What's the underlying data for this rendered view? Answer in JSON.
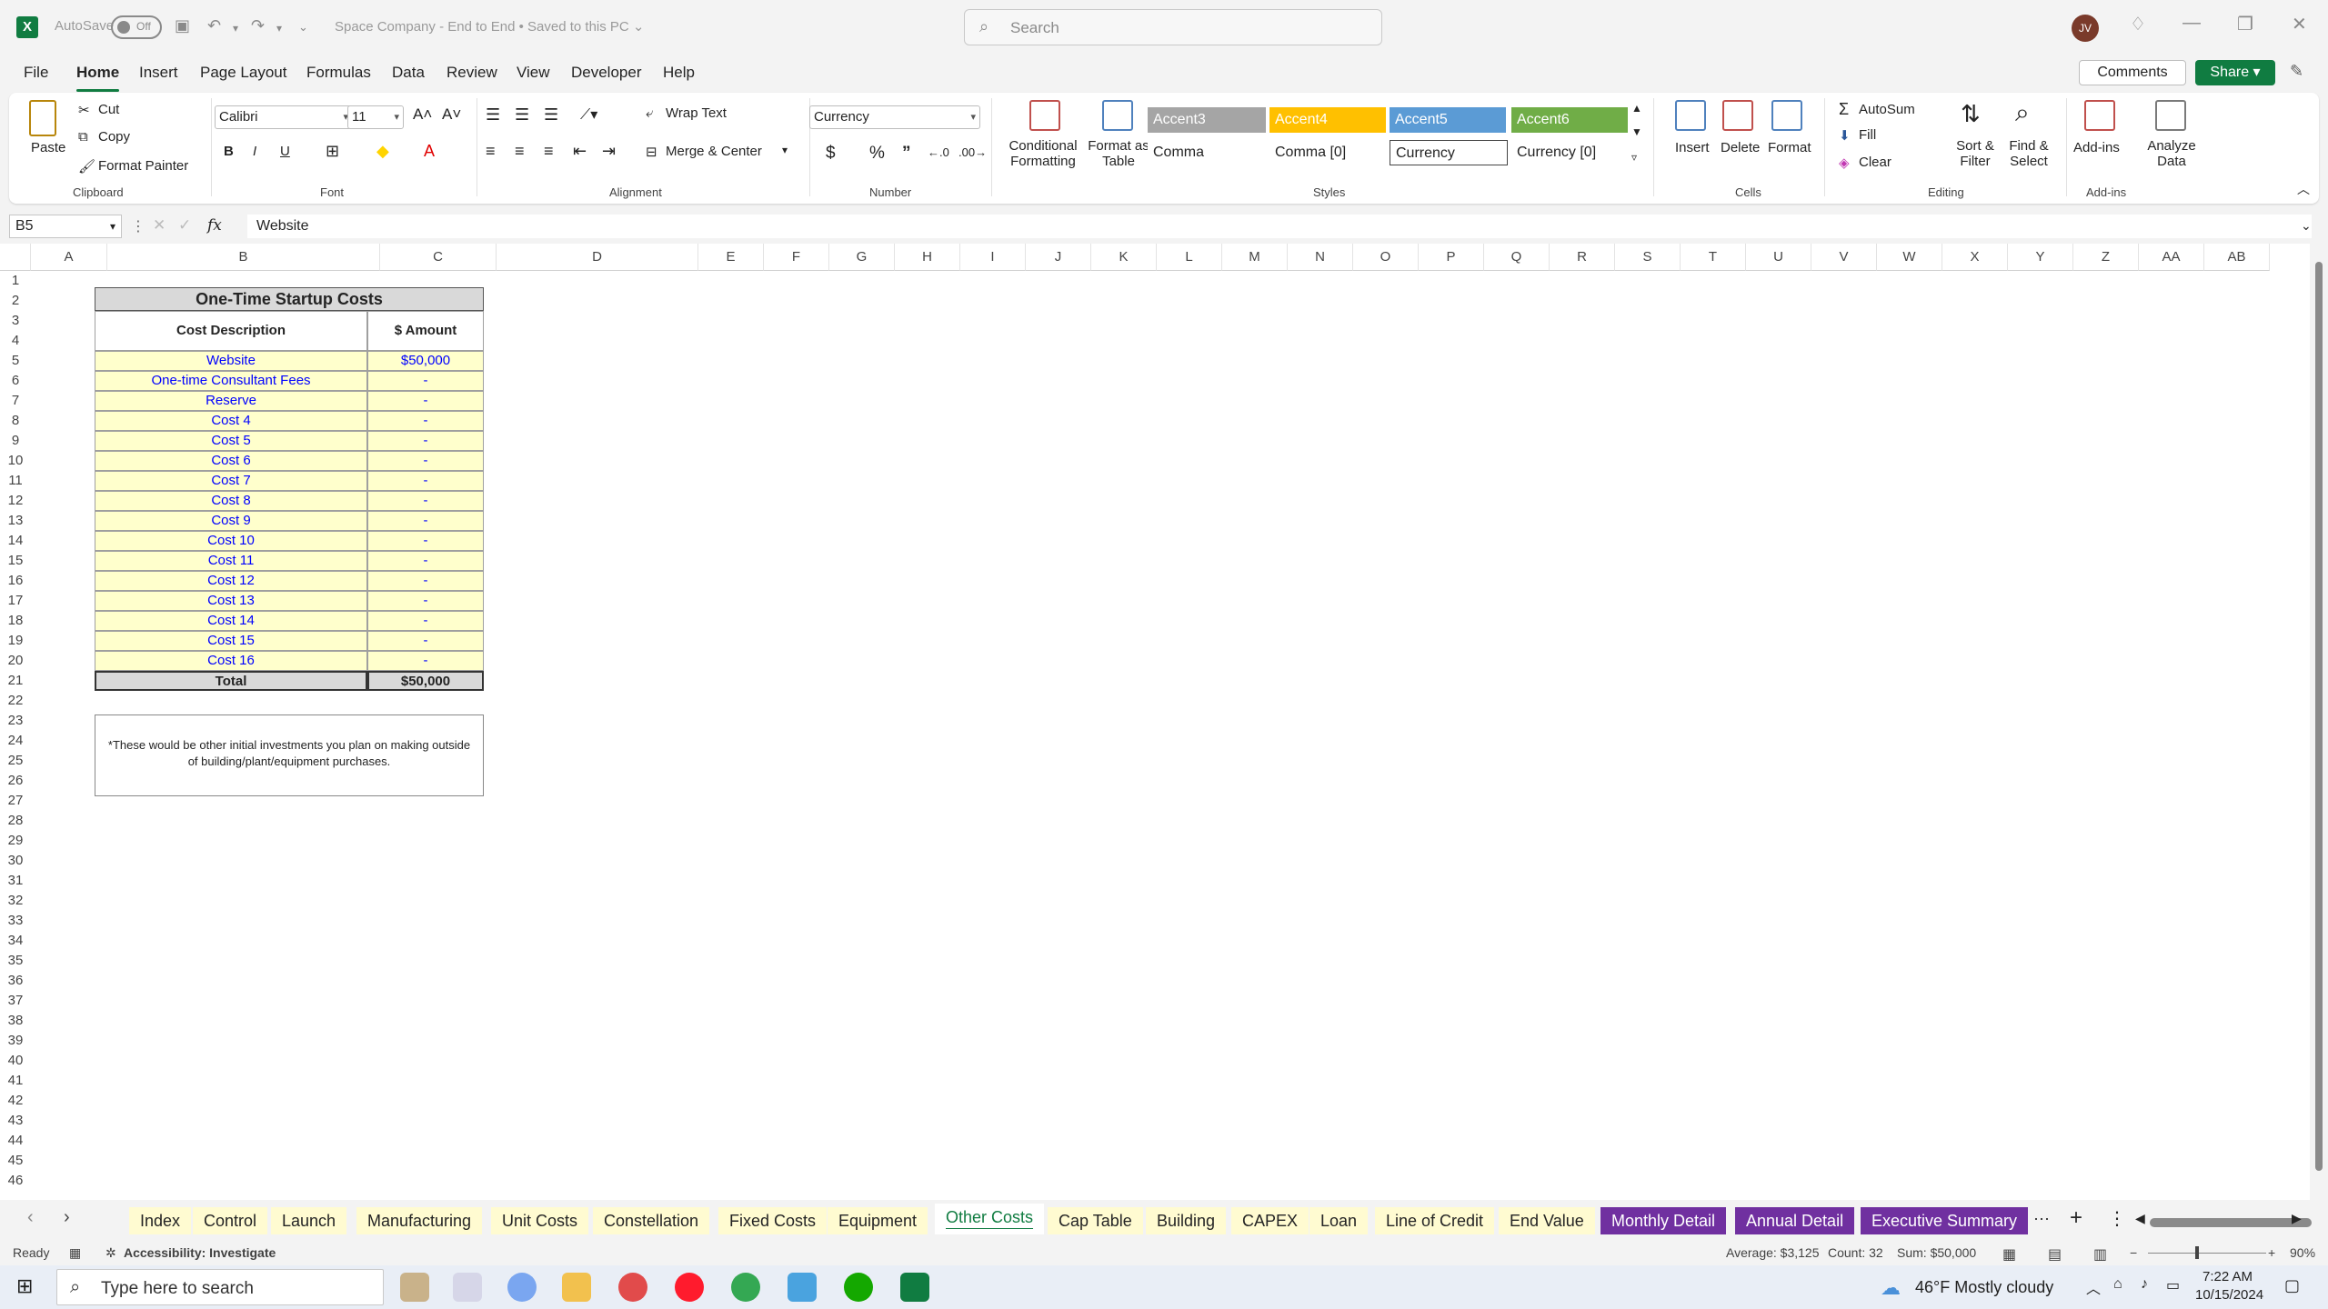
{
  "titlebar": {
    "autosave_label": "AutoSave",
    "autosave_state": "Off",
    "doc_title": "Space Company - End to End • Saved to this PC ⌄",
    "search_placeholder": "Search",
    "user_initials": "JV"
  },
  "menu": {
    "items": [
      "File",
      "Home",
      "Insert",
      "Page Layout",
      "Formulas",
      "Data",
      "Review",
      "View",
      "Developer",
      "Help"
    ],
    "active": "Home",
    "comments_label": "Comments",
    "share_label": "Share"
  },
  "ribbon": {
    "clipboard": {
      "paste": "Paste",
      "cut": "Cut",
      "copy": "Copy",
      "format_painter": "Format Painter",
      "label": "Clipboard"
    },
    "font": {
      "name": "Calibri",
      "size": "11",
      "label": "Font",
      "bold": "B",
      "italic": "I",
      "underline": "U"
    },
    "alignment": {
      "wrap_text": "Wrap Text",
      "merge_center": "Merge & Center",
      "label": "Alignment"
    },
    "number": {
      "format": "Currency",
      "currency_symbol": "$",
      "percent": "%",
      "comma": "”",
      "label": "Number"
    },
    "styles": {
      "conditional_formatting": "Conditional Formatting",
      "format_as_table": "Format as Table",
      "cells": [
        {
          "name": "Accent3",
          "bg": "#a5a5a5",
          "fg": "#ffffff"
        },
        {
          "name": "Accent4",
          "bg": "#ffc000",
          "fg": "#ffffff"
        },
        {
          "name": "Accent5",
          "bg": "#5b9bd5",
          "fg": "#ffffff"
        },
        {
          "name": "Accent6",
          "bg": "#70ad47",
          "fg": "#ffffff"
        },
        {
          "name": "Comma",
          "bg": "#ffffff",
          "fg": "#242424"
        },
        {
          "name": "Comma [0]",
          "bg": "#ffffff",
          "fg": "#242424"
        },
        {
          "name": "Currency",
          "bg": "#ffffff",
          "fg": "#242424"
        },
        {
          "name": "Currency [0]",
          "bg": "#ffffff",
          "fg": "#242424"
        }
      ],
      "label": "Styles"
    },
    "cells": {
      "insert": "Insert",
      "delete": "Delete",
      "format": "Format",
      "label": "Cells"
    },
    "editing": {
      "autosum": "AutoSum",
      "fill": "Fill",
      "clear": "Clear",
      "sort_filter": "Sort & Filter",
      "find_select": "Find & Select",
      "label": "Editing"
    },
    "addins": {
      "addins": "Add-ins",
      "analyze": "Analyze Data",
      "label": "Add-ins"
    }
  },
  "formula_bar": {
    "name_box": "B5",
    "fx": "fx",
    "value": "Website"
  },
  "columns": [
    "A",
    "B",
    "C",
    "D",
    "E",
    "F",
    "G",
    "H",
    "I",
    "J",
    "K",
    "L",
    "M",
    "N",
    "O",
    "P",
    "Q",
    "R",
    "S",
    "T",
    "U",
    "V",
    "W",
    "X",
    "Y",
    "Z",
    "AA",
    "AB"
  ],
  "rows": [
    "1",
    "2",
    "3",
    "4",
    "5",
    "6",
    "7",
    "8",
    "9",
    "10",
    "11",
    "12",
    "13",
    "14",
    "15",
    "16",
    "17",
    "18",
    "19",
    "20",
    "21",
    "22",
    "23",
    "24",
    "25",
    "26",
    "27",
    "28",
    "29",
    "30",
    "31",
    "32",
    "33",
    "34",
    "35",
    "36",
    "37",
    "38",
    "39",
    "40",
    "41",
    "42",
    "43",
    "44",
    "45",
    "46"
  ],
  "table": {
    "title": "One-Time Startup Costs",
    "header_desc": "Cost Description",
    "header_amount": "$ Amount",
    "rows": [
      {
        "desc": "Website",
        "amount": "$50,000"
      },
      {
        "desc": "One-time Consultant Fees",
        "amount": "-"
      },
      {
        "desc": "Reserve",
        "amount": "-"
      },
      {
        "desc": "Cost 4",
        "amount": "-"
      },
      {
        "desc": "Cost 5",
        "amount": "-"
      },
      {
        "desc": "Cost 6",
        "amount": "-"
      },
      {
        "desc": "Cost 7",
        "amount": "-"
      },
      {
        "desc": "Cost 8",
        "amount": "-"
      },
      {
        "desc": "Cost 9",
        "amount": "-"
      },
      {
        "desc": "Cost 10",
        "amount": "-"
      },
      {
        "desc": "Cost 11",
        "amount": "-"
      },
      {
        "desc": "Cost 12",
        "amount": "-"
      },
      {
        "desc": "Cost 13",
        "amount": "-"
      },
      {
        "desc": "Cost 14",
        "amount": "-"
      },
      {
        "desc": "Cost 15",
        "amount": "-"
      },
      {
        "desc": "Cost 16",
        "amount": "-"
      }
    ],
    "total_label": "Total",
    "total_value": "$50,000",
    "note": "*These would be other initial investments you plan on making outside of building/plant/equipment purchases."
  },
  "sheet_tabs": [
    {
      "name": "Index",
      "style": "yellow"
    },
    {
      "name": "Control",
      "style": "yellow"
    },
    {
      "name": "Launch",
      "style": "yellow"
    },
    {
      "name": "Manufacturing",
      "style": "yellow"
    },
    {
      "name": "Unit Costs",
      "style": "yellow"
    },
    {
      "name": "Constellation",
      "style": "yellow"
    },
    {
      "name": "Fixed Costs",
      "style": "yellow"
    },
    {
      "name": "Equipment",
      "style": "yellow"
    },
    {
      "name": "Other Costs",
      "style": "active"
    },
    {
      "name": "Cap Table",
      "style": "yellow"
    },
    {
      "name": "Building",
      "style": "yellow"
    },
    {
      "name": "CAPEX",
      "style": "yellow"
    },
    {
      "name": "Loan",
      "style": "yellow"
    },
    {
      "name": "Line of Credit",
      "style": "yellow"
    },
    {
      "name": "End Value",
      "style": "yellow"
    },
    {
      "name": "Monthly Detail",
      "style": "purple"
    },
    {
      "name": "Annual Detail",
      "style": "purple"
    },
    {
      "name": "Executive Summary",
      "style": "purple"
    }
  ],
  "status_bar": {
    "ready": "Ready",
    "accessibility": "Accessibility: Investigate",
    "average": "Average: $3,125",
    "count": "Count: 32",
    "sum": "Sum: $50,000",
    "zoom": "90%"
  },
  "taskbar": {
    "search_placeholder": "Type here to search",
    "weather": "46°F  Mostly cloudy",
    "time": "7:22 AM",
    "date": "10/15/2024"
  }
}
